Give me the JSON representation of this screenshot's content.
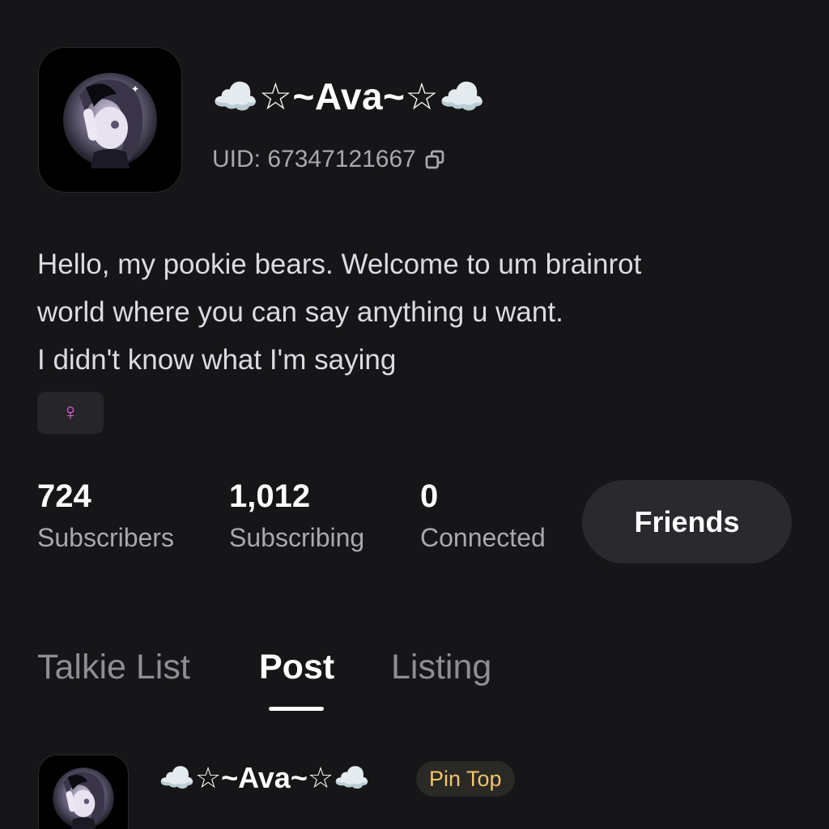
{
  "profile": {
    "name": "☁️☆~Ava~☆☁️",
    "uid": "UID: 67347121667",
    "bio_lines": [
      "Hello, my pookie bears. Welcome to um brainrot",
      "world where you can say anything u want.",
      "I didn't know what I'm saying"
    ],
    "gender_symbol": "♀"
  },
  "stats": {
    "subscribers": {
      "value": "724",
      "label": "Subscribers"
    },
    "subscribing": {
      "value": "1,012",
      "label": "Subscribing"
    },
    "connected": {
      "value": "0",
      "label": "Connected"
    }
  },
  "friends_button": {
    "label": "Friends"
  },
  "tabs": [
    {
      "label": "Talkie List",
      "active": false
    },
    {
      "label": "Post",
      "active": true
    },
    {
      "label": "Listing",
      "active": false
    }
  ],
  "post": {
    "author": "☁️☆~Ava~☆☁️",
    "badge": "Pin Top"
  },
  "colors": {
    "background": "#161517",
    "gender_accent": "#e35ee0",
    "pin_badge_text": "#f1c46a",
    "muted_text": "#a9a8ad"
  },
  "icons": [
    "avatar-image",
    "copy-icon",
    "female-icon"
  ]
}
